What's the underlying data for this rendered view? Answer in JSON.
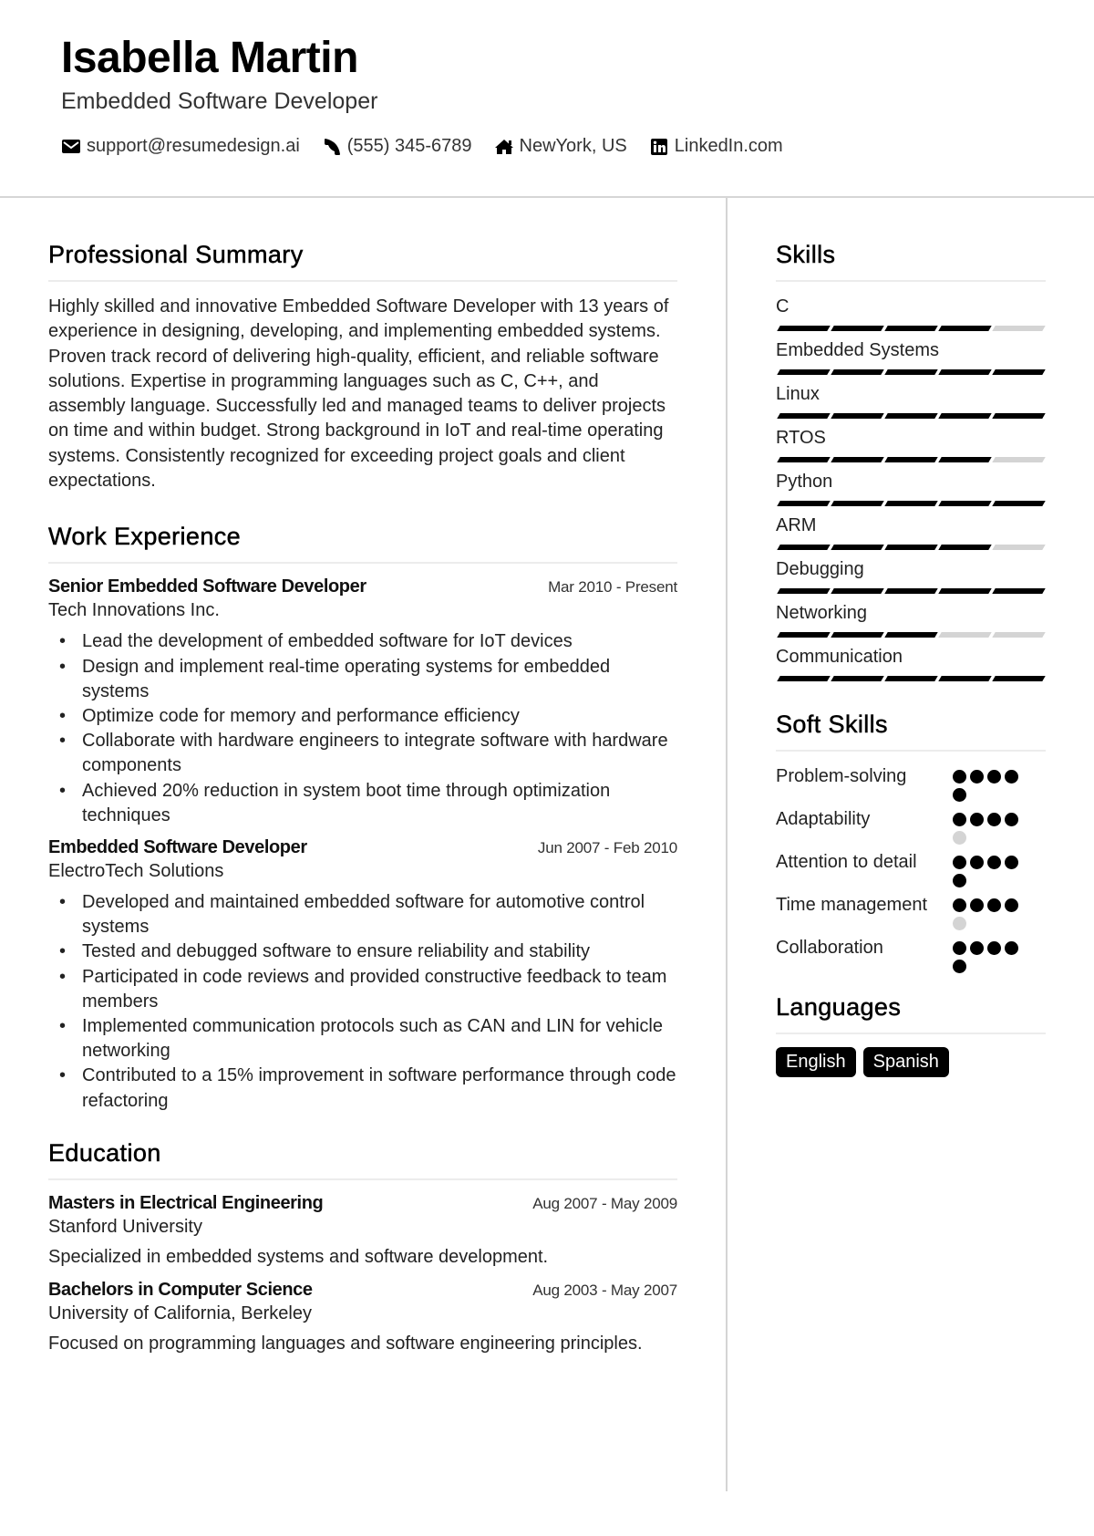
{
  "header": {
    "name": "Isabella Martin",
    "title": "Embedded Software Developer",
    "contacts": [
      {
        "icon": "envelope-icon",
        "text": "support@resumedesign.ai"
      },
      {
        "icon": "phone-icon",
        "text": "(555) 345-6789"
      },
      {
        "icon": "home-icon",
        "text": "NewYork, US"
      },
      {
        "icon": "linkedin-icon",
        "text": "LinkedIn.com"
      }
    ]
  },
  "summary": {
    "heading": "Professional Summary",
    "text": "Highly skilled and innovative Embedded Software Developer with 13 years of experience in designing, developing, and implementing embedded systems. Proven track record of delivering high-quality, efficient, and reliable software solutions. Expertise in programming languages such as C, C++, and assembly language. Successfully led and managed teams to deliver projects on time and within budget. Strong background in IoT and real-time operating systems. Consistently recognized for exceeding project goals and client expectations."
  },
  "experience": {
    "heading": "Work Experience",
    "jobs": [
      {
        "title": "Senior Embedded Software Developer",
        "date": "Mar 2010 - Present",
        "company": "Tech Innovations Inc.",
        "bullets": [
          "Lead the development of embedded software for IoT devices",
          "Design and implement real-time operating systems for embedded systems",
          "Optimize code for memory and performance efficiency",
          "Collaborate with hardware engineers to integrate software with hardware components",
          "Achieved 20% reduction in system boot time through optimization techniques"
        ]
      },
      {
        "title": "Embedded Software Developer",
        "date": "Jun 2007 - Feb 2010",
        "company": "ElectroTech Solutions",
        "bullets": [
          "Developed and maintained embedded software for automotive control systems",
          "Tested and debugged software to ensure reliability and stability",
          "Participated in code reviews and provided constructive feedback to team members",
          "Implemented communication protocols such as CAN and LIN for vehicle networking",
          "Contributed to a 15% improvement in software performance through code refactoring"
        ]
      }
    ]
  },
  "education": {
    "heading": "Education",
    "items": [
      {
        "degree": "Masters in Electrical Engineering",
        "date": "Aug 2007 - May 2009",
        "school": "Stanford University",
        "description": "Specialized in embedded systems and software development."
      },
      {
        "degree": "Bachelors in Computer Science",
        "date": "Aug 2003 - May 2007",
        "school": "University of California, Berkeley",
        "description": "Focused on programming languages and software engineering principles."
      }
    ]
  },
  "skills": {
    "heading": "Skills",
    "max_level": 5,
    "items": [
      {
        "name": "C",
        "level": 4
      },
      {
        "name": "Embedded Systems",
        "level": 5
      },
      {
        "name": "Linux",
        "level": 5
      },
      {
        "name": "RTOS",
        "level": 4
      },
      {
        "name": "Python",
        "level": 5
      },
      {
        "name": "ARM",
        "level": 4
      },
      {
        "name": "Debugging",
        "level": 5
      },
      {
        "name": "Networking",
        "level": 3
      },
      {
        "name": "Communication",
        "level": 5
      }
    ]
  },
  "soft_skills": {
    "heading": "Soft Skills",
    "max_level": 5,
    "items": [
      {
        "name": "Problem-solving",
        "level": 5
      },
      {
        "name": "Adaptability",
        "level": 4
      },
      {
        "name": "Attention to detail",
        "level": 5
      },
      {
        "name": "Time management",
        "level": 4
      },
      {
        "name": "Collaboration",
        "level": 5
      }
    ]
  },
  "languages": {
    "heading": "Languages",
    "items": [
      "English",
      "Spanish"
    ]
  }
}
